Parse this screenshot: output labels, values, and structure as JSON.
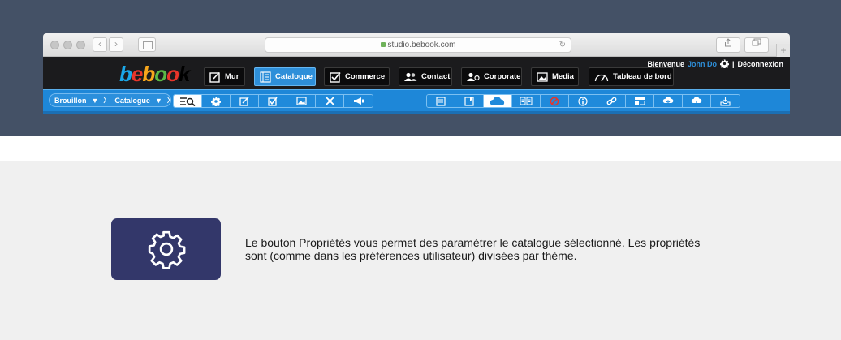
{
  "browser": {
    "url": "studio.bebook.com",
    "plus": "+"
  },
  "app": {
    "logo": [
      "b",
      "e",
      "b",
      "o",
      "o",
      "k"
    ],
    "nav": [
      {
        "label": "Mur",
        "icon": "edit-icon"
      },
      {
        "label": "Catalogue",
        "icon": "catalogue-icon",
        "active": true
      },
      {
        "label": "Commerce",
        "icon": "commerce-icon"
      },
      {
        "label": "Contact",
        "icon": "contacts-icon"
      },
      {
        "label": "Corporate",
        "icon": "corporate-icon"
      },
      {
        "label": "Media",
        "icon": "image-icon"
      },
      {
        "label": "Tableau de bord",
        "icon": "speedometer-icon"
      }
    ],
    "welcome": "Bienvenue",
    "user": "John Do",
    "separator": "|",
    "logout": "Déconnexion"
  },
  "toolbar": {
    "crumb1": "Brouillon",
    "crumb2": "Catalogue",
    "crumb_arrow": "▼",
    "crumb_sep": "〉"
  },
  "content": {
    "description": "Le bouton Propriétés vous permet des paramétrer le catalogue sélectionné. Les propriétés sont (comme dans les préférences utilisateur) divisées par thème."
  },
  "colors": {
    "top_band": "#445166",
    "toolbar_blue": "#1e87d8",
    "active_nav": "#2e8fd9",
    "gear_card": "#33376a"
  }
}
